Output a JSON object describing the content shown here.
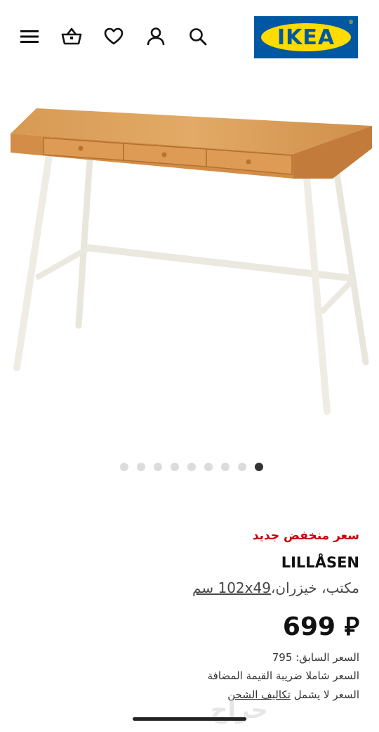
{
  "header": {
    "icons": [
      "menu-icon",
      "shopping-basket-icon",
      "heart-icon",
      "account-icon",
      "search-icon"
    ],
    "logo_text": "IKEA",
    "logo_mark": "®"
  },
  "colors": {
    "ikea_blue": "#0058a3",
    "ikea_yellow": "#ffdb00",
    "sale_red": "#cc0008"
  },
  "gallery": {
    "total_images": 9,
    "active_index": 9
  },
  "product": {
    "badge": "سعر منخفض جديد",
    "name": "LILLÅSEN",
    "description_prefix": "مكتب، خيزران،",
    "dimensions": "102x49",
    "unit": "سم",
    "price": "699",
    "currency_symbol": "⃁",
    "previous_price_label": "السعر السابق: 795",
    "vat_note": "السعر شاملا ضريبة القيمة المضافة",
    "shipping_prefix": "السعر لا يشمل",
    "shipping_link": "تكاليف الشحن"
  },
  "watermark": "حراج"
}
